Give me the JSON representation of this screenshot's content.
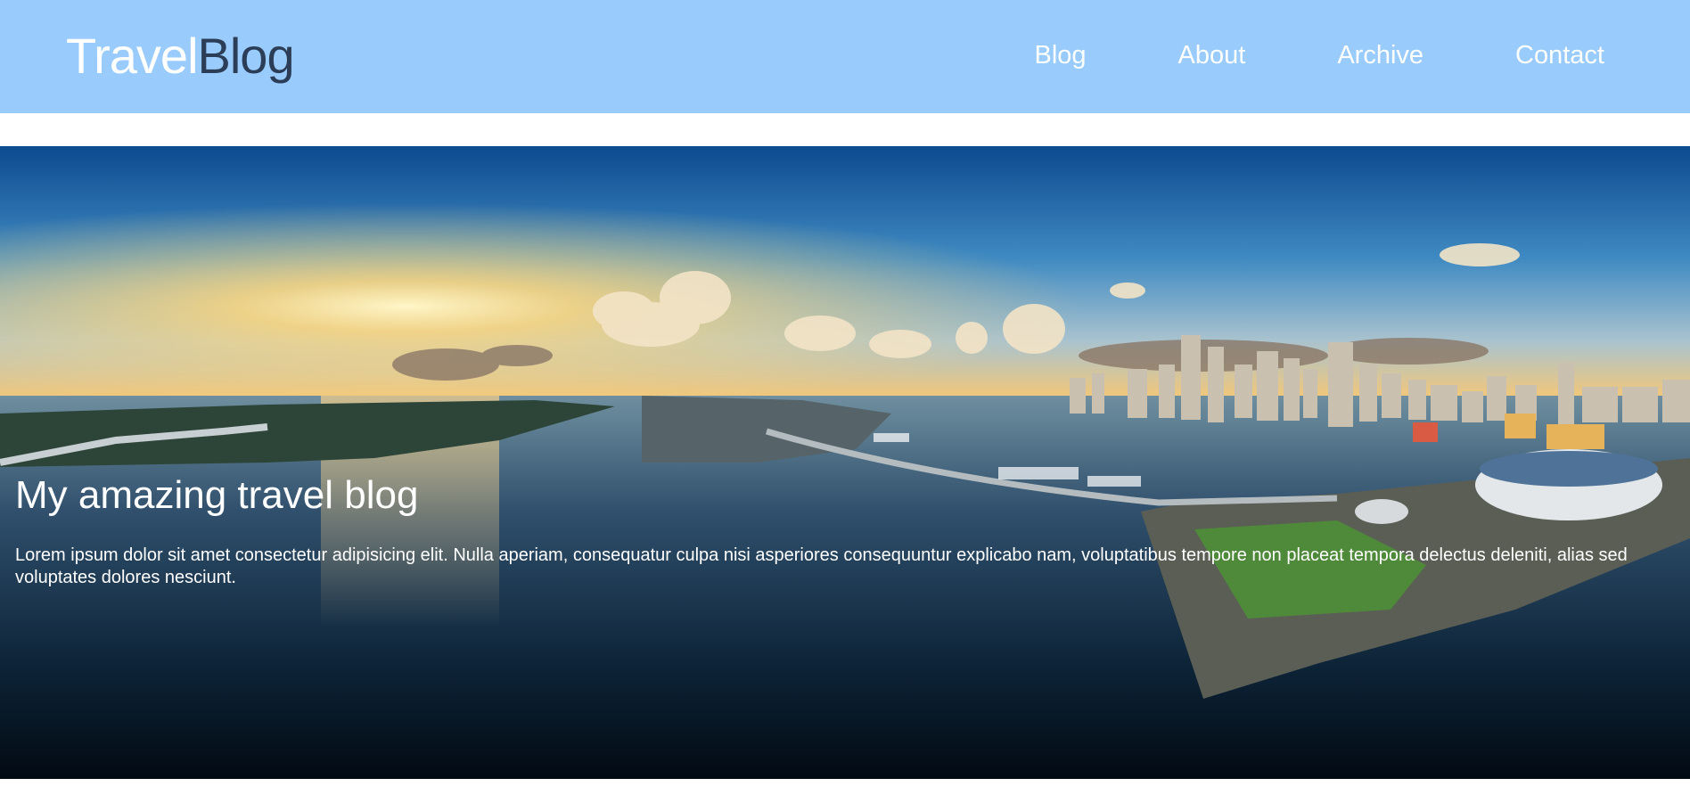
{
  "header": {
    "logo_part_1": "Travel",
    "logo_part_2": "Blog",
    "nav": [
      {
        "label": "Blog"
      },
      {
        "label": "About"
      },
      {
        "label": "Archive"
      },
      {
        "label": "Contact"
      }
    ]
  },
  "hero": {
    "title": "My amazing travel blog",
    "text": "Lorem ipsum dolor sit amet consectetur adipisicing elit. Nulla aperiam, consequatur culpa nisi asperiores consequuntur explicabo nam, voluptatibus tempore non placeat tempora delectus deleniti, alias sed voluptates dolores nesciunt.",
    "image_subject": "aerial-city-bay-panorama"
  },
  "colors": {
    "header_bg": "#99cbfc",
    "logo_dark": "#2c3e57",
    "nav_text": "#ffffff"
  }
}
